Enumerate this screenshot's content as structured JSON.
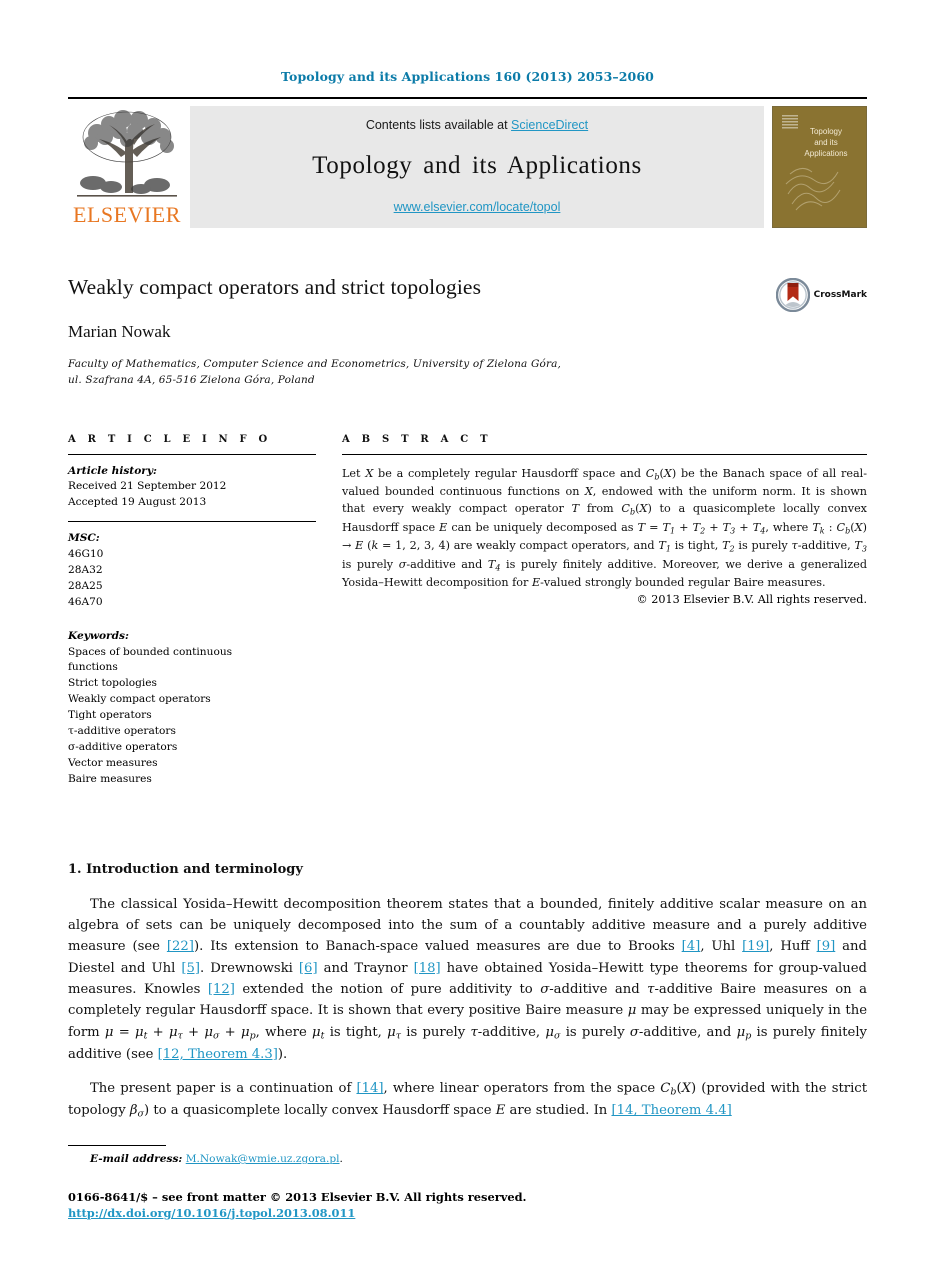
{
  "running_head": "Topology and its Applications 160 (2013) 2053–2060",
  "masthead": {
    "publisher_name": "ELSEVIER",
    "contents_prefix": "Contents lists available at ",
    "sciencedirect_link": "ScienceDirect",
    "journal_name": "Topology and its Applications",
    "journal_url": "www.elsevier.com/locate/topol",
    "cover_title_line1": "Topology",
    "cover_title_line2": "and its",
    "cover_title_line3": "Applications"
  },
  "article": {
    "title": "Weakly compact operators and strict topologies",
    "author": "Marian Nowak",
    "affiliation_line1": "Faculty of Mathematics, Computer Science and Econometrics, University of Zielona Góra,",
    "affiliation_line2": "ul. Szafrana 4A, 65-516 Zielona Góra, Poland",
    "crossmark_label": "CrossMark"
  },
  "info": {
    "heading": "A R T I C L E    I N F O",
    "history_label": "Article history:",
    "received": "Received 21 September 2012",
    "accepted": "Accepted 19 August 2013",
    "msc_label": "MSC:",
    "msc": [
      "46G10",
      "28A32",
      "28A25",
      "46A70"
    ],
    "keywords_label": "Keywords:",
    "keywords": [
      "Spaces of bounded continuous",
      "functions",
      "Strict topologies",
      "Weakly compact operators",
      "Tight operators",
      "τ-additive operators",
      "σ-additive operators",
      "Vector measures",
      "Baire measures"
    ]
  },
  "abstract": {
    "heading": "A B S T R A C T",
    "copyright": "© 2013 Elsevier B.V. All rights reserved."
  },
  "body": {
    "section_title": "1. Introduction and terminology",
    "refs": {
      "r22": "[22]",
      "r4": "[4]",
      "r19": "[19]",
      "r9": "[9]",
      "r5": "[5]",
      "r6": "[6]",
      "r18": "[18]",
      "r12": "[12]",
      "r12thm": "[12, Theorem 4.3]",
      "r14": "[14]",
      "r14thm": "[14, Theorem 4.4]"
    }
  },
  "footer": {
    "email_label": "E-mail address:",
    "email": "M.Nowak@wmie.uz.zgora.pl",
    "issn_line": "0166-8641/$ – see front matter  © 2013 Elsevier B.V. All rights reserved.",
    "doi": "http://dx.doi.org/10.1016/j.topol.2013.08.011"
  },
  "colors": {
    "link": "#2196c4",
    "running_head": "#0b7ba8",
    "elsevier_orange": "#E87722",
    "cover_bg": "#8a7331",
    "banner_bg": "#e8e8e8"
  }
}
